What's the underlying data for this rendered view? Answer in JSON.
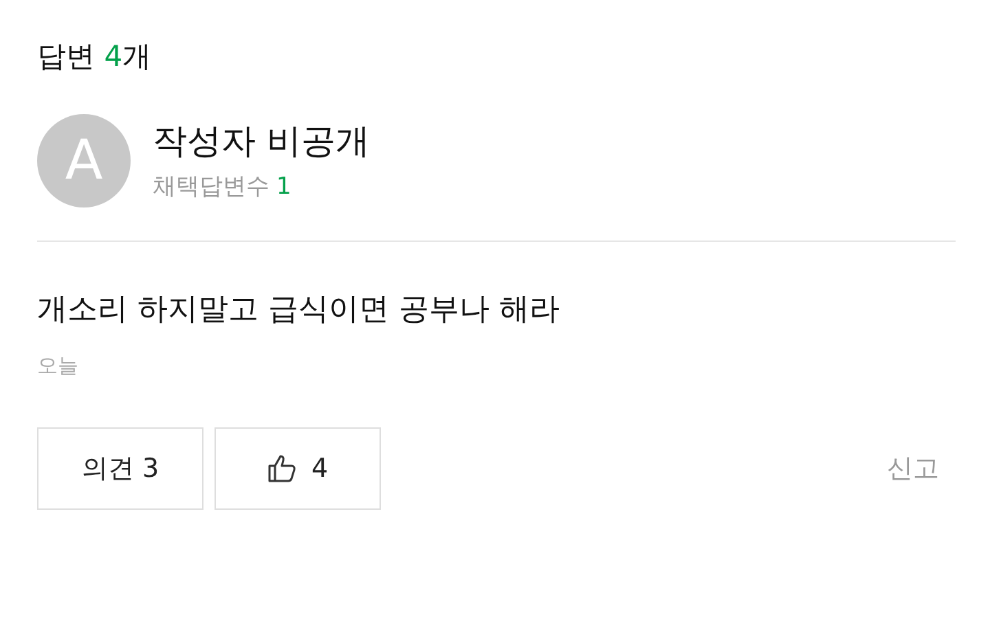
{
  "header": {
    "title": "답변",
    "count": "4",
    "unit": "개"
  },
  "author": {
    "avatar_letter": "A",
    "name": "작성자 비공개",
    "stat_label": "채택답변수",
    "stat_value": "1"
  },
  "answer": {
    "text": "개소리 하지말고 급식이면 공부나 해라",
    "date": "오늘"
  },
  "actions": {
    "comments": "의견 3",
    "likes": "4",
    "report": "신고"
  }
}
